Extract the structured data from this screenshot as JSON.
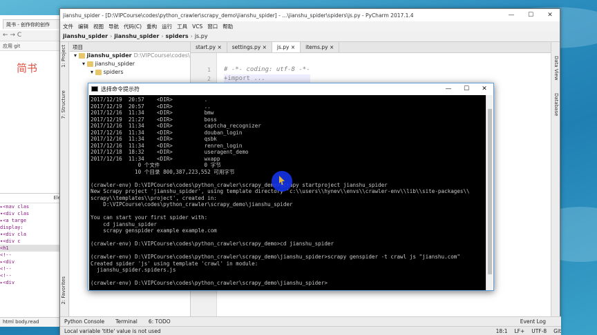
{
  "browser": {
    "tab_title": "简书 - 创作你的创作",
    "bookmarks": "应用  git",
    "logo": "简书",
    "devtools_tab": "Ele",
    "dom_lines": [
      "▸<nav clas",
      "▾<div clas",
      "  ▸<a targe",
      "  display:",
      "  ▾<div cla",
      "   ▾<div c",
      "    <h1",
      "    <!--",
      "   ▸<div",
      "    <!--",
      "    <!--",
      "   ▸<div"
    ],
    "footer": "html   body.read"
  },
  "pycharm": {
    "title": "jianshu_spider - [D:\\VIPCourse\\codes\\python_crawler\\scrapy_demo\\jianshu_spider] - ...\\jianshu_spider\\spiders\\js.py - PyCharm 2017.1.4",
    "menu": [
      "文件",
      "编辑",
      "视图",
      "导航",
      "代码(C)",
      "重构",
      "运行",
      "工具",
      "VCS",
      "窗口",
      "帮助"
    ],
    "breadcrumbs": [
      "jianshu_spider",
      "jianshu_spider",
      "spiders",
      "js.py"
    ],
    "left_strip": [
      "1: Project",
      "7: Structure",
      "2: Favorites"
    ],
    "right_strip": [
      "Data View",
      "Database"
    ],
    "project_header": "项目",
    "project_tree": [
      {
        "label": "jianshu_spider",
        "extra": "D:\\VIPCourse\\codes\\pytho",
        "level": 0
      },
      {
        "label": "jianshu_spider",
        "extra": "",
        "level": 1
      },
      {
        "label": "spiders",
        "extra": "",
        "level": 2
      }
    ],
    "editor_tabs": [
      "start.py",
      "settings.py",
      "js.py",
      "items.py"
    ],
    "active_tab": "js.py",
    "line_numbers": [
      "1",
      "2"
    ],
    "code": [
      "# -*- coding: utf-8 -*-",
      "+import ..."
    ],
    "tool_windows": [
      "Python Console",
      "Terminal",
      "6: TODO"
    ],
    "event_log": "Event Log",
    "status_left": "Local variable 'title' value is not used",
    "status_right": [
      "18:1",
      "LF+",
      "UTF-8",
      "Git"
    ]
  },
  "cmd": {
    "title": "选择命令提示符",
    "lines": [
      "2017/12/19  20:57    <DIR>          .",
      "2017/12/19  20:57    <DIR>          ..",
      "2017/12/16  11:34    <DIR>          bmw",
      "2017/12/19  21:27    <DIR>          boss",
      "2017/12/16  11:34    <DIR>          captcha_recognizer",
      "2017/12/16  11:34    <DIR>          douban_login",
      "2017/12/16  11:34    <DIR>          qsbk",
      "2017/12/16  11:34    <DIR>          renren_login",
      "2017/12/18  18:32    <DIR>          useragent_demo",
      "2017/12/16  11:34    <DIR>          wxapp",
      "               0 个文件              0 字节",
      "              10 个目录 800,387,223,552 可用字节",
      "",
      "(crawler-env) D:\\VIPCourse\\codes\\python_crawler\\scrapy_demo>scrapy startproject jianshu_spider",
      "New Scrapy project 'jianshu_spider', using template directory 'c:\\\\users\\\\hynev\\\\envs\\\\crawler-env\\\\lib\\\\site-packages\\\\",
      "scrapy\\\\templates\\\\project', created in:",
      "    D:\\VIPCourse\\codes\\python_crawler\\scrapy_demo\\jianshu_spider",
      "",
      "You can start your first spider with:",
      "    cd jianshu_spider",
      "    scrapy genspider example example.com",
      "",
      "(crawler-env) D:\\VIPCourse\\codes\\python_crawler\\scrapy_demo>cd jianshu_spider",
      "",
      "(crawler-env) D:\\VIPCourse\\codes\\python_crawler\\scrapy_demo\\jianshu_spider>scrapy genspider -t crawl js \"jianshu.com\"",
      "Created spider 'js' using template 'crawl' in module:",
      "  jianshu_spider.spiders.js",
      "",
      "(crawler-env) D:\\VIPCourse\\codes\\python_crawler\\scrapy_demo\\jianshu_spider>"
    ]
  }
}
